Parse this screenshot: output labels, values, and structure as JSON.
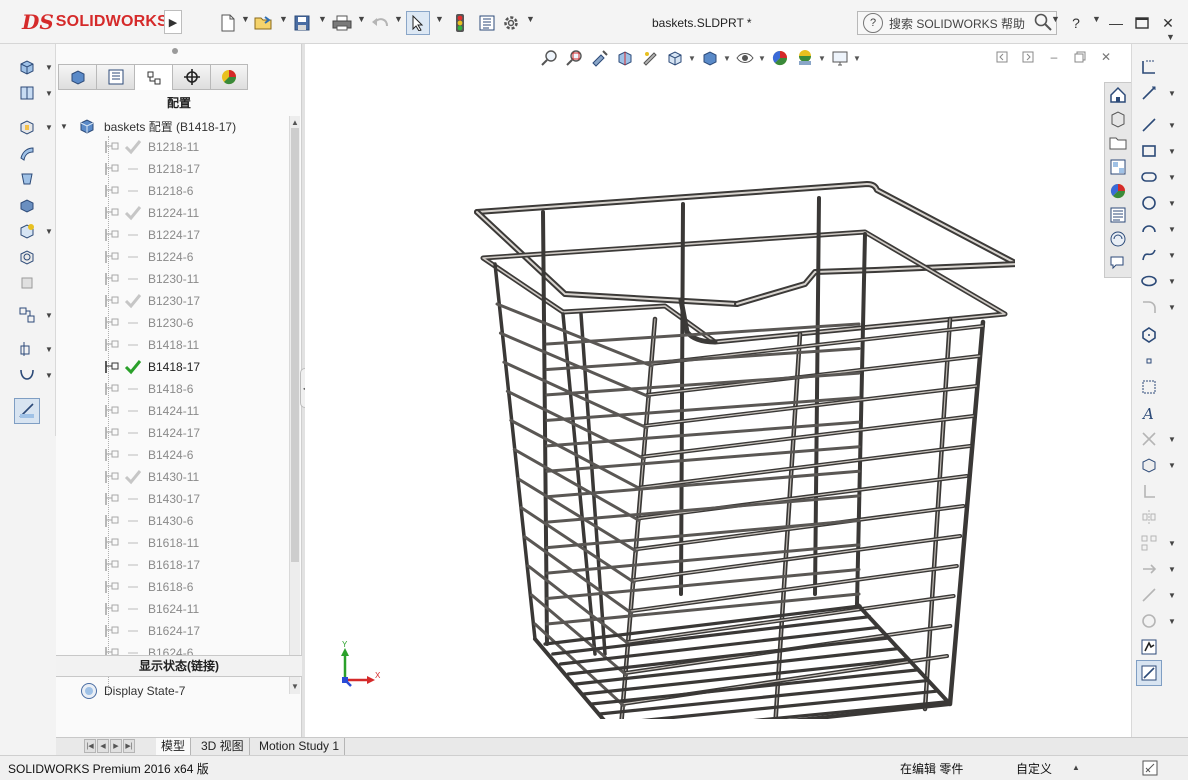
{
  "app": {
    "brand": "SOLIDWORKS",
    "doc_title": "baskets.SLDPRT *",
    "search_placeholder": "搜索 SOLIDWORKS 帮助",
    "help_label": "?",
    "accent": "#d52a2a"
  },
  "toolbar_icons": [
    "new-document-icon",
    "open-folder-icon",
    "save-icon",
    "print-icon",
    "undo-icon",
    "select-pointer-icon",
    "traffic-light-rebuild-icon",
    "file-properties-icon",
    "options-gear-icon"
  ],
  "feature_manager": {
    "panel_title": "配置",
    "tabs": [
      "feature-tree-tab",
      "property-manager-tab",
      "configuration-manager-tab",
      "dimxpert-tab",
      "display-manager-tab"
    ],
    "root_label": "baskets 配置  (B1418-17)",
    "configs": [
      {
        "name": "B1218-11",
        "checked": true
      },
      {
        "name": "B1218-17",
        "checked": false
      },
      {
        "name": "B1218-6",
        "checked": false
      },
      {
        "name": "B1224-11",
        "checked": true
      },
      {
        "name": "B1224-17",
        "checked": false
      },
      {
        "name": "B1224-6",
        "checked": false
      },
      {
        "name": "B1230-11",
        "checked": false
      },
      {
        "name": "B1230-17",
        "checked": true
      },
      {
        "name": "B1230-6",
        "checked": false
      },
      {
        "name": "B1418-11",
        "checked": false
      },
      {
        "name": "B1418-17",
        "checked": true,
        "active": true
      },
      {
        "name": "B1418-6",
        "checked": false
      },
      {
        "name": "B1424-11",
        "checked": false
      },
      {
        "name": "B1424-17",
        "checked": false
      },
      {
        "name": "B1424-6",
        "checked": false
      },
      {
        "name": "B1430-11",
        "checked": true
      },
      {
        "name": "B1430-17",
        "checked": false
      },
      {
        "name": "B1430-6",
        "checked": false
      },
      {
        "name": "B1618-11",
        "checked": false
      },
      {
        "name": "B1618-17",
        "checked": false
      },
      {
        "name": "B1618-6",
        "checked": false
      },
      {
        "name": "B1624-11",
        "checked": false
      },
      {
        "name": "B1624-17",
        "checked": false
      },
      {
        "name": "B1624-6",
        "checked": false
      }
    ],
    "display_state_title": "显示状态(链接)",
    "display_state_item": "Display State-7"
  },
  "triad": {
    "x": "X",
    "y": "Y"
  },
  "bottom_tabs": {
    "model": "模型",
    "view3d": "3D 视图",
    "motion": "Motion Study 1"
  },
  "status": {
    "product": "SOLIDWORKS Premium 2016 x64 版",
    "editing": "在编辑 零件",
    "custom": "自定义"
  }
}
